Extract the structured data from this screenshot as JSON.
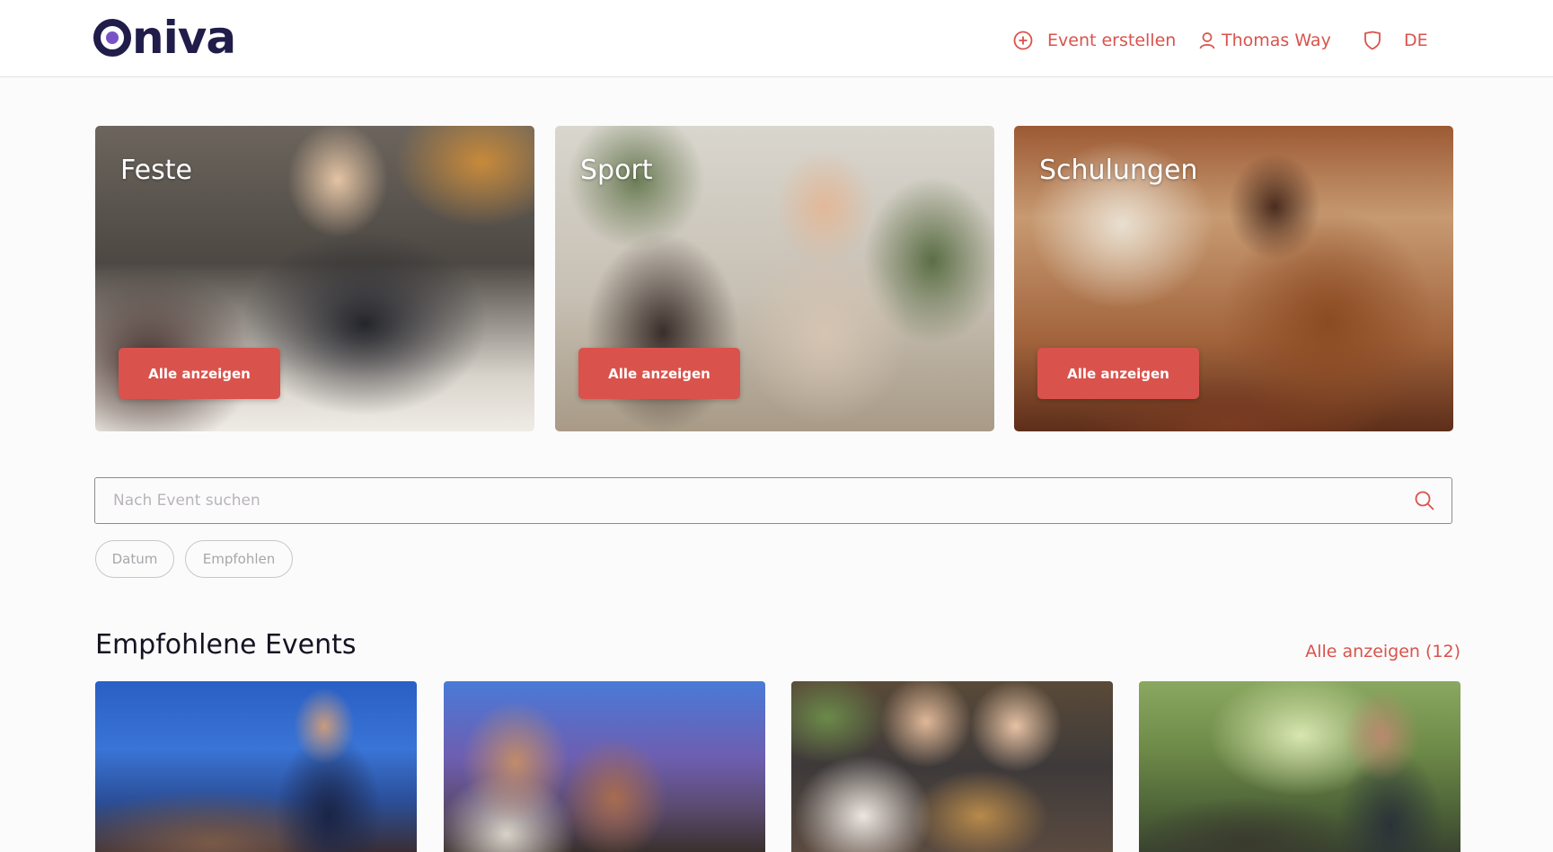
{
  "brand": {
    "logo_text": "niva",
    "logo_full": "Oniva"
  },
  "header": {
    "create_event": "Event erstellen",
    "user_name": "Thomas Way",
    "language": "DE"
  },
  "categories": [
    {
      "title": "Feste",
      "button": "Alle anzeigen"
    },
    {
      "title": "Sport",
      "button": "Alle anzeigen"
    },
    {
      "title": "Schulungen",
      "button": "Alle anzeigen"
    }
  ],
  "search": {
    "placeholder": "Nach Event suchen",
    "value": ""
  },
  "filters": [
    "Datum",
    "Empfohlen"
  ],
  "recommended": {
    "title": "Empfohlene Events",
    "show_all": "Alle anzeigen (12)"
  },
  "colors": {
    "accent": "#d9534c",
    "brand_dark": "#201d4a",
    "brand_purple": "#7a52c8"
  }
}
